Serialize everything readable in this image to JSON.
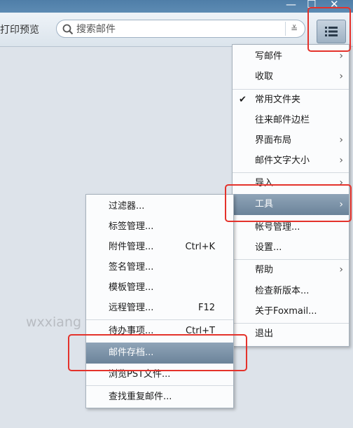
{
  "window": {
    "minimize": "—",
    "maximize": "☐",
    "close": "✕"
  },
  "toolbar": {
    "print_preview": "打印预览",
    "search_placeholder": "搜索邮件",
    "search_dropdown": "≚"
  },
  "watermark": "wxxiang",
  "main_menu": {
    "items": [
      {
        "label": "写邮件",
        "arrow": "›"
      },
      {
        "label": "收取",
        "arrow": "›"
      },
      {
        "label": "常用文件夹",
        "check": "✔"
      },
      {
        "label": "往来邮件边栏"
      },
      {
        "label": "界面布局",
        "arrow": "›"
      },
      {
        "label": "邮件文字大小",
        "arrow": "›"
      },
      {
        "label": "导入",
        "arrow": "›"
      },
      {
        "label": "工具",
        "arrow": "›"
      },
      {
        "label": "帐号管理..."
      },
      {
        "label": "设置..."
      },
      {
        "label": "帮助",
        "arrow": "›"
      },
      {
        "label": "检查新版本..."
      },
      {
        "label": "关于Foxmail..."
      },
      {
        "label": "退出"
      }
    ]
  },
  "tools_menu": {
    "items": [
      {
        "label": "过滤器..."
      },
      {
        "label": "标签管理..."
      },
      {
        "label": "附件管理...",
        "shortcut": "Ctrl+K"
      },
      {
        "label": "签名管理..."
      },
      {
        "label": "模板管理..."
      },
      {
        "label": "远程管理...",
        "shortcut": "F12"
      },
      {
        "label": "待办事项...",
        "shortcut": "Ctrl+T"
      },
      {
        "label": "邮件存档..."
      },
      {
        "label": "浏览PST文件..."
      },
      {
        "label": "查找重复邮件..."
      }
    ]
  },
  "colors": {
    "highlight": "#e4322b",
    "menu_selected": "#7a90a5"
  }
}
